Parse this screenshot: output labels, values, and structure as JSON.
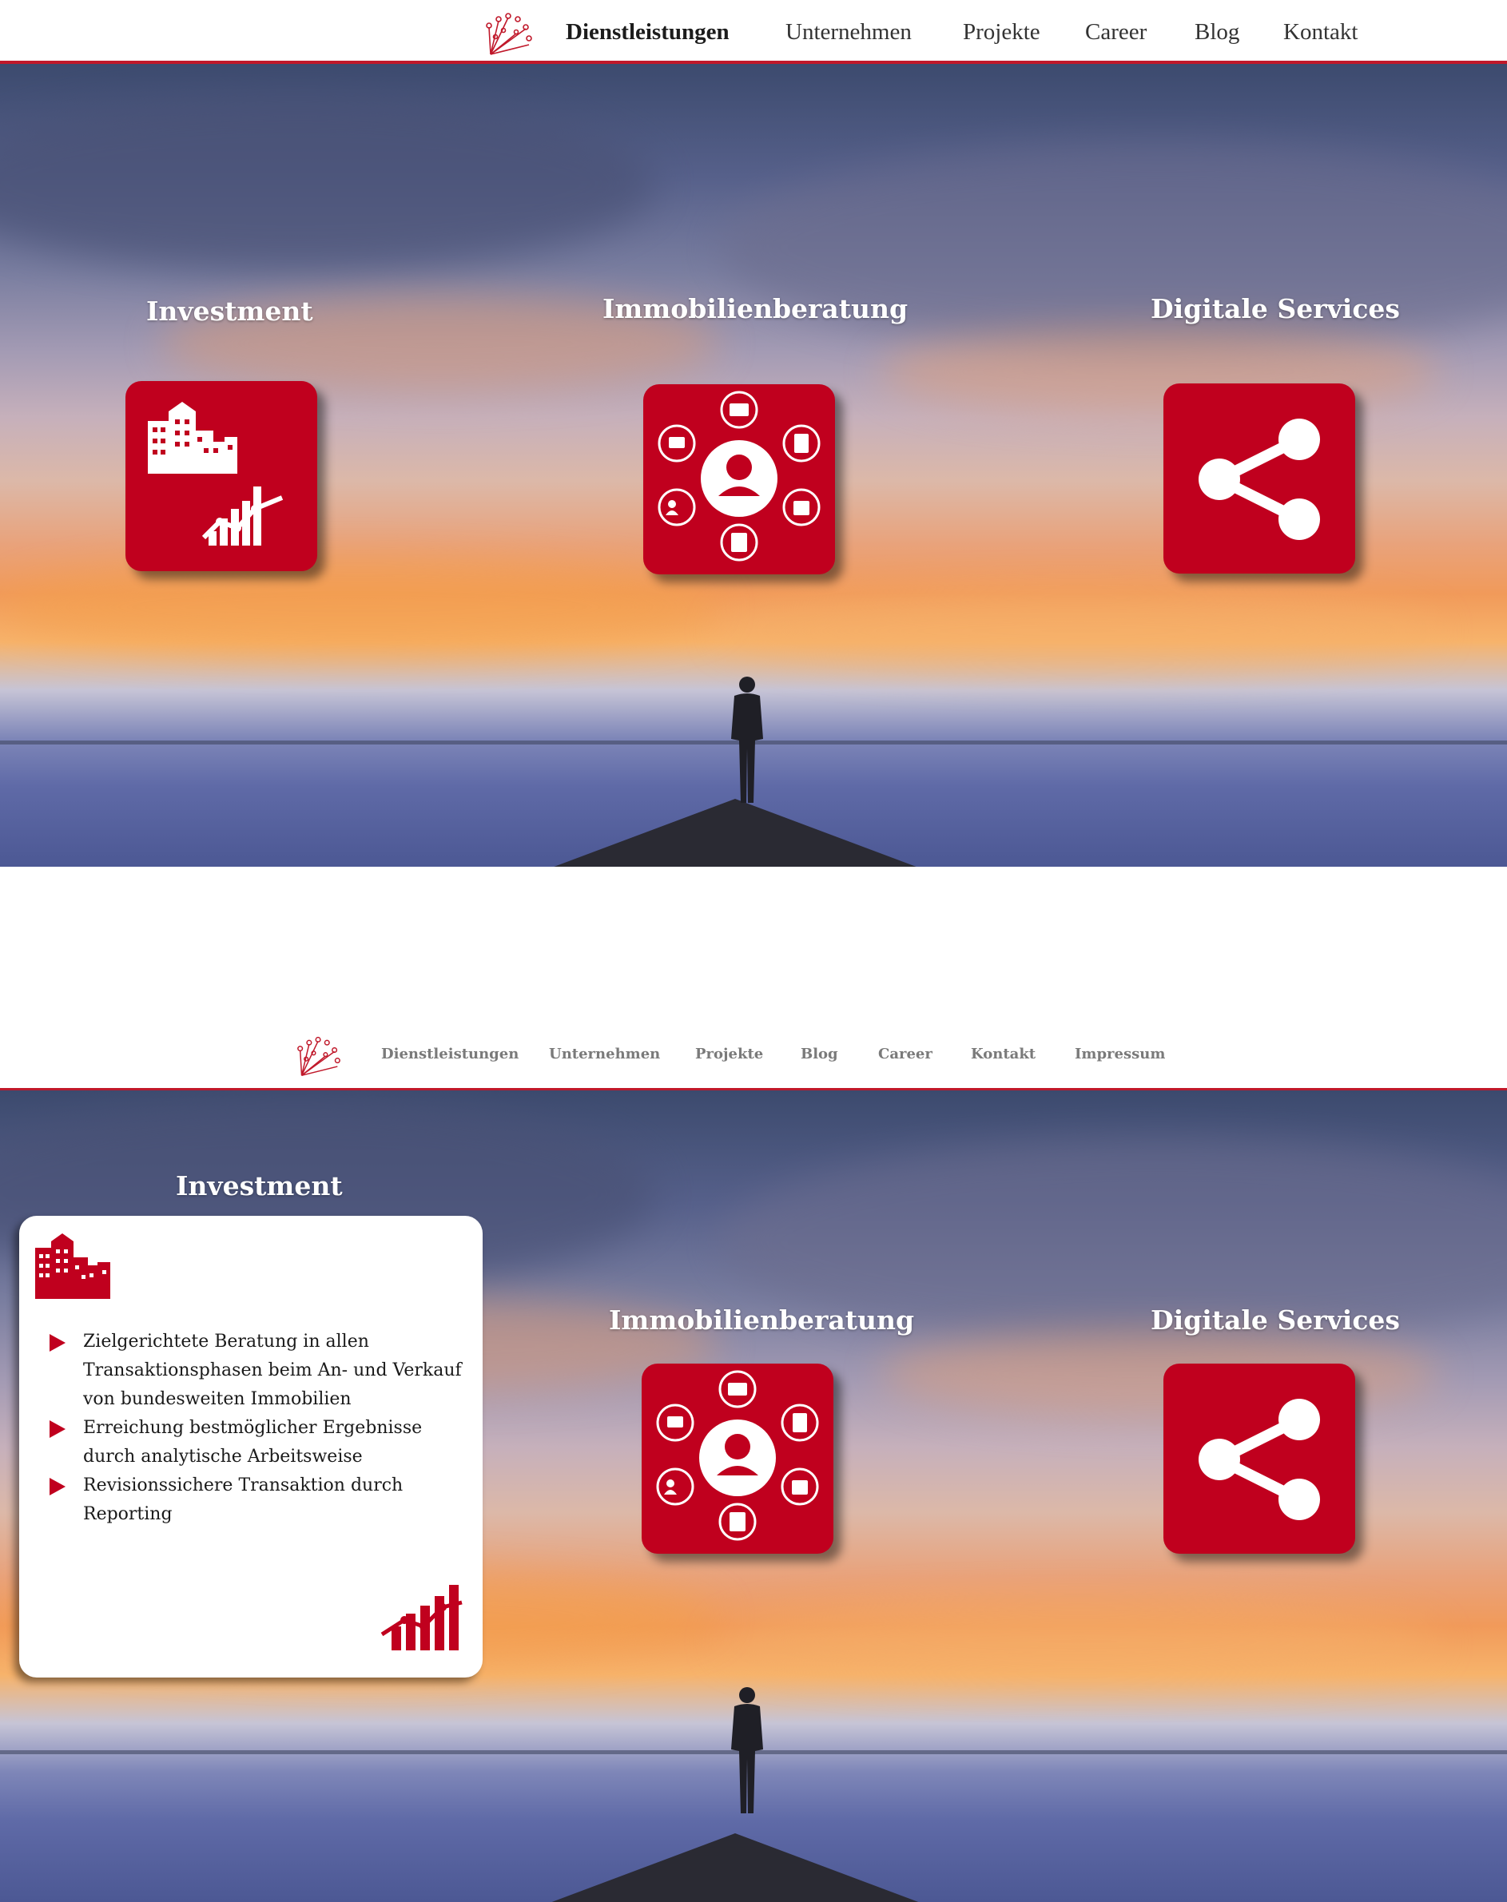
{
  "colors": {
    "accent": "#c0001e",
    "nav_line": "#c0182a"
  },
  "screen1": {
    "nav": {
      "items": [
        "Dienstleistungen",
        "Unternehmen",
        "Projekte",
        "Career",
        "Blog",
        "Kontakt"
      ],
      "active": "Dienstleistungen"
    },
    "services": [
      {
        "title": "Investment",
        "icon": "buildings-chart-icon"
      },
      {
        "title": "Immobilienberatung",
        "icon": "person-network-icon"
      },
      {
        "title": "Digitale Services",
        "icon": "share-icon"
      }
    ]
  },
  "screen2": {
    "nav": {
      "items": [
        "Dienstleistungen",
        "Unternehmen",
        "Projekte",
        "Blog",
        "Career",
        "Kontakt",
        "Impressum"
      ]
    },
    "services": [
      {
        "title": "Investment",
        "icon": "buildings-icon"
      },
      {
        "title": "Immobilienberatung",
        "icon": "person-network-icon"
      },
      {
        "title": "Digitale Services",
        "icon": "share-icon"
      }
    ],
    "investment_card": {
      "bullets": [
        "Zielgerichtete Beratung in allen\nTransaktionsphasen beim An- und Verkauf\n von bundesweiten Immobilien",
        "Erreichung bestmöglicher Ergebnisse\ndurch analytische Arbeitsweise",
        "Revisionssichere Transaktion durch\nReporting"
      ],
      "bottom_icon": "growth-chart-icon"
    }
  }
}
